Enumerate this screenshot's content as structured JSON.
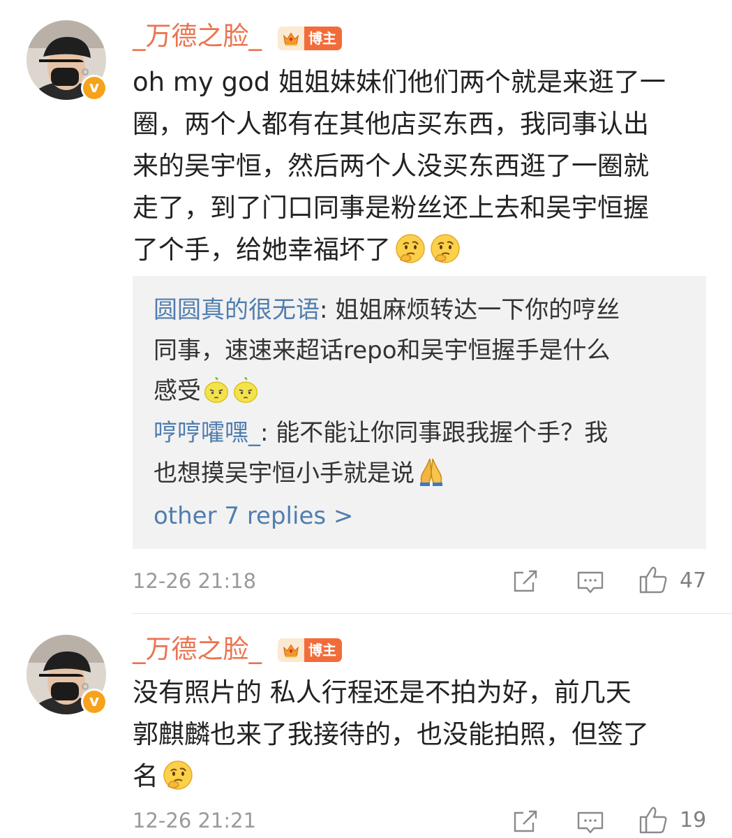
{
  "comments": [
    {
      "username": "_万德之脸_",
      "badge": "博主",
      "verified_mark": "v",
      "lines": [
        "oh my god 姐姐妹妹们他们两个就是来逛了一",
        "圈，两个人都有在其他店买东西，我同事认出",
        "来的吴宇恒，然后两个人没买东西逛了一圈就",
        "走了，到了门口同事是粉丝还上去和吴宇恒握",
        "了个手，给她幸福坏了"
      ],
      "emoji": [
        "thinking-face-icon",
        "thinking-face-icon"
      ],
      "replies": [
        {
          "name": "圆圆真的很无语",
          "lines": [
            ": 姐姐麻烦转达一下你的哼丝",
            "同事，速速来超话repo和吴宇恒握手是什么",
            "感受"
          ],
          "emoji": [
            "lemon-face-icon",
            "lemon-face-icon"
          ]
        },
        {
          "name": "哼哼嚯嘿_",
          "lines": [
            ": 能不能让你同事跟我握个手？我",
            "也想摸吴宇恒小手就是说"
          ],
          "emoji": [
            "folded-hands-icon"
          ]
        }
      ],
      "more_replies": "other 7 replies >",
      "time": "12-26 21:18",
      "likes": "47"
    },
    {
      "username": "_万德之脸_",
      "badge": "博主",
      "verified_mark": "v",
      "lines": [
        "没有照片的 私人行程还是不拍为好，前几天",
        "郭麒麟也来了我接待的，也没能拍照，但签了",
        "名"
      ],
      "emoji": [
        "thinking-face-icon"
      ],
      "time": "12-26 21:21",
      "likes": "19"
    }
  ],
  "colors": {
    "username": "#eb7350",
    "link": "#507daf",
    "badge": "#f26c3a",
    "verified": "#f7a21b",
    "reply_bg": "#f2f2f2"
  }
}
